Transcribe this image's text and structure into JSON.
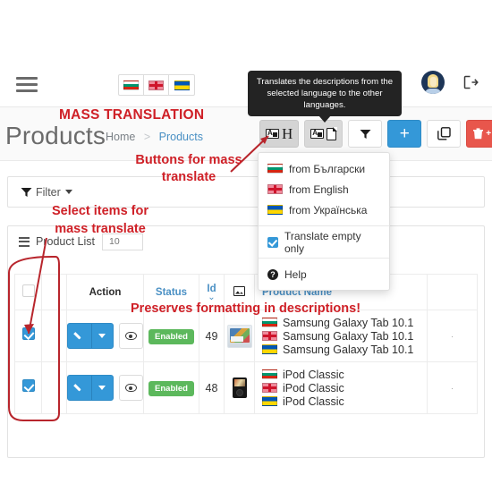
{
  "navbar": {
    "menu_icon": "hamburger-icon",
    "languages": [
      {
        "code": "bg",
        "icon": "flag-bulgaria-icon",
        "title": "Български"
      },
      {
        "code": "en",
        "icon": "flag-english-icon",
        "title": "English"
      },
      {
        "code": "uk",
        "icon": "flag-ukraine-icon",
        "title": "Українська"
      }
    ],
    "avatar_icon": "user-avatar",
    "logout_icon": "sign-out-icon"
  },
  "header": {
    "title": "Products",
    "breadcrumb": {
      "home": "Home",
      "separator": ">",
      "current": "Products"
    }
  },
  "toolbar": {
    "buttons": [
      {
        "name": "mass-translate-headings-button",
        "icon": "translate-heading-icon",
        "glyph": "H",
        "style": "grey",
        "active": true
      },
      {
        "name": "mass-translate-descriptions-button",
        "icon": "translate-document-icon",
        "style": "grey"
      },
      {
        "name": "filter-button",
        "icon": "funnel-icon",
        "style": "white"
      },
      {
        "name": "add-new-product-button",
        "label": "+",
        "style": "blue"
      },
      {
        "name": "duplicate-button",
        "icon": "copy-icon",
        "style": "white"
      },
      {
        "name": "delete-images-button",
        "icon": "trash-plus-image-icon",
        "label": "+",
        "style": "red"
      }
    ]
  },
  "tooltip": {
    "text": "Translates the descriptions from the selected language to the other languages."
  },
  "dropdown": {
    "items": [
      {
        "icon": "flag-bulgaria-icon",
        "label": "from Български"
      },
      {
        "icon": "flag-english-icon",
        "label": "from English"
      },
      {
        "icon": "flag-ukraine-icon",
        "label": "from Українська"
      }
    ],
    "checkbox": {
      "label": "Translate empty only",
      "checked": true
    },
    "help": {
      "icon": "help-circle-icon",
      "label": "Help"
    }
  },
  "filter_panel": {
    "icon": "funnel-icon",
    "label": "Filter",
    "caret": "chevron-down-icon"
  },
  "list_panel": {
    "icon": "list-icon",
    "title": "Product List",
    "count": "10"
  },
  "table": {
    "columns": [
      {
        "name": "select-all-checkbox",
        "label": ""
      },
      {
        "name": "col-spacer",
        "label": ""
      },
      {
        "name": "col-action",
        "label": "Action"
      },
      {
        "name": "col-status",
        "label": "Status"
      },
      {
        "name": "col-id",
        "label": "Id",
        "sorted": "desc",
        "sort_icon": "chevron-down-icon"
      },
      {
        "name": "col-image",
        "label": "",
        "icon": "image-icon"
      },
      {
        "name": "col-product-name",
        "label": "Product Name"
      },
      {
        "name": "col-extra",
        "label": ""
      }
    ],
    "rows": [
      {
        "selected": true,
        "edit_label": "edit-icon",
        "preview_label": "eye-icon",
        "status": "Enabled",
        "id": "49",
        "thumb": "tablet-thumbnail",
        "names": [
          {
            "icon": "flag-bulgaria-icon",
            "text": "Samsung Galaxy Tab 10.1"
          },
          {
            "icon": "flag-english-icon",
            "text": "Samsung Galaxy Tab 10.1"
          },
          {
            "icon": "flag-ukraine-icon",
            "text": "Samsung Galaxy Tab 10.1"
          }
        ],
        "extra": "·"
      },
      {
        "selected": true,
        "edit_label": "edit-icon",
        "preview_label": "eye-icon",
        "status": "Enabled",
        "id": "48",
        "thumb": "ipod-thumbnail",
        "names": [
          {
            "icon": "flag-bulgaria-icon",
            "text": "iPod Classic"
          },
          {
            "icon": "flag-english-icon",
            "text": "iPod Classic"
          },
          {
            "icon": "flag-ukraine-icon",
            "text": "iPod Classic"
          }
        ],
        "extra": "·"
      }
    ]
  },
  "annotations": [
    {
      "name": "annotation-mass-translation",
      "text": "MASS TRANSLATION"
    },
    {
      "name": "annotation-buttons-for-mass-translate",
      "text": "Buttons for mass translate"
    },
    {
      "name": "annotation-select-items",
      "text": "Select items for mass translate"
    },
    {
      "name": "annotation-preserves-formatting",
      "text": "Preserves formatting in descriptions!"
    }
  ],
  "colors": {
    "annotation_red": "#cf2027",
    "accent_blue": "#3498d8",
    "link_blue": "#4a90c4",
    "status_green": "#5cb85c",
    "danger_red": "#e8564c",
    "tooltip_bg": "#232323"
  }
}
